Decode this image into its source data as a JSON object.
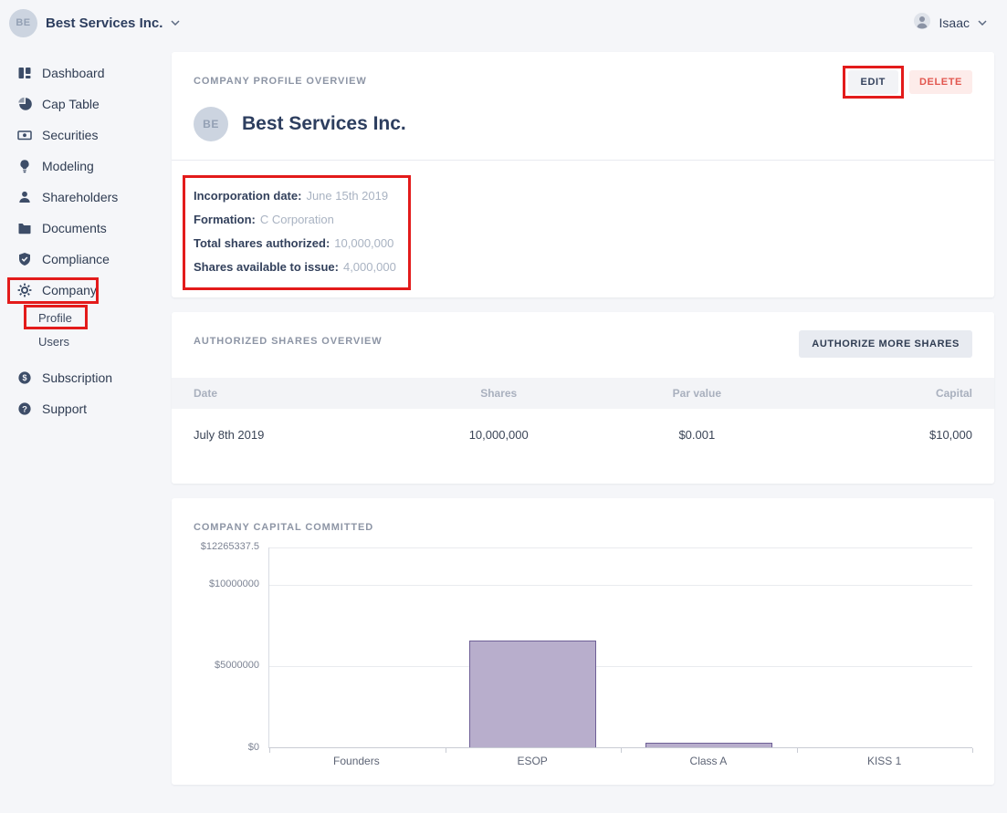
{
  "colors": {
    "annotation-red": "#e31b1b",
    "delete-bg": "#fdecea",
    "delete-text": "#e2574f",
    "navy": "#2d3e5f",
    "button-gray-bg": "#e8ebf1",
    "card-bg": "#ffffff",
    "page-bg": "#f5f6f9"
  },
  "topbar": {
    "company_initials": "BE",
    "company_name": "Best Services Inc.",
    "user_name": "Isaac",
    "icons": [
      "chevron-down-icon",
      "user-icon"
    ]
  },
  "sidebar": {
    "items": [
      {
        "label": "Dashboard",
        "icon": "dashboard-icon"
      },
      {
        "label": "Cap Table",
        "icon": "cap-table-icon"
      },
      {
        "label": "Securities",
        "icon": "securities-icon"
      },
      {
        "label": "Modeling",
        "icon": "modeling-icon"
      },
      {
        "label": "Shareholders",
        "icon": "shareholders-icon"
      },
      {
        "label": "Documents",
        "icon": "documents-icon"
      },
      {
        "label": "Compliance",
        "icon": "compliance-icon"
      },
      {
        "label": "Company",
        "icon": "company-icon"
      },
      {
        "label": "Subscription",
        "icon": "subscription-icon"
      },
      {
        "label": "Support",
        "icon": "support-icon"
      }
    ],
    "company_subitems": [
      {
        "label": "Profile"
      },
      {
        "label": "Users"
      }
    ]
  },
  "profile_card": {
    "title": "COMPANY PROFILE OVERVIEW",
    "edit_button": "EDIT",
    "delete_button": "DELETE",
    "avatar_initials": "BE",
    "company_name": "Best Services Inc.",
    "fields": [
      {
        "label": "Incorporation date:",
        "value": "June 15th 2019"
      },
      {
        "label": "Formation:",
        "value": "C Corporation"
      },
      {
        "label": "Total shares authorized:",
        "value": "10,000,000"
      },
      {
        "label": "Shares available to issue:",
        "value": "4,000,000"
      }
    ]
  },
  "authorized_card": {
    "title": "AUTHORIZED SHARES OVERVIEW",
    "button": "AUTHORIZE MORE SHARES",
    "columns": [
      "Date",
      "Shares",
      "Par value",
      "Capital"
    ],
    "rows": [
      [
        "July 8th 2019",
        "10,000,000",
        "$0.001",
        "$10,000"
      ]
    ]
  },
  "capital_card": {
    "title": "COMPANY CAPITAL COMMITTED"
  },
  "chart_data": {
    "type": "bar",
    "title": "COMPANY CAPITAL COMMITTED",
    "categories": [
      "Founders",
      "ESOP",
      "Class A",
      "KISS 1"
    ],
    "values": [
      0,
      6500000,
      300000,
      0
    ],
    "xlabel": "",
    "ylabel": "",
    "ylim": [
      0,
      12265337.5
    ],
    "yticks": [
      {
        "value": 12265337.5,
        "label": "$12265337.5"
      },
      {
        "value": 10000000,
        "label": "$10000000"
      },
      {
        "value": 5000000,
        "label": "$5000000"
      },
      {
        "value": 0,
        "label": "$0"
      }
    ],
    "grid": true,
    "legend": false,
    "bar_fill": "#b8aecc",
    "bar_border": "#6e5f96"
  },
  "annotations": {
    "note": "red highlight boxes drawn over EDIT button, company details block, Company nav item, Profile sub-item",
    "color": "#e31b1b"
  }
}
